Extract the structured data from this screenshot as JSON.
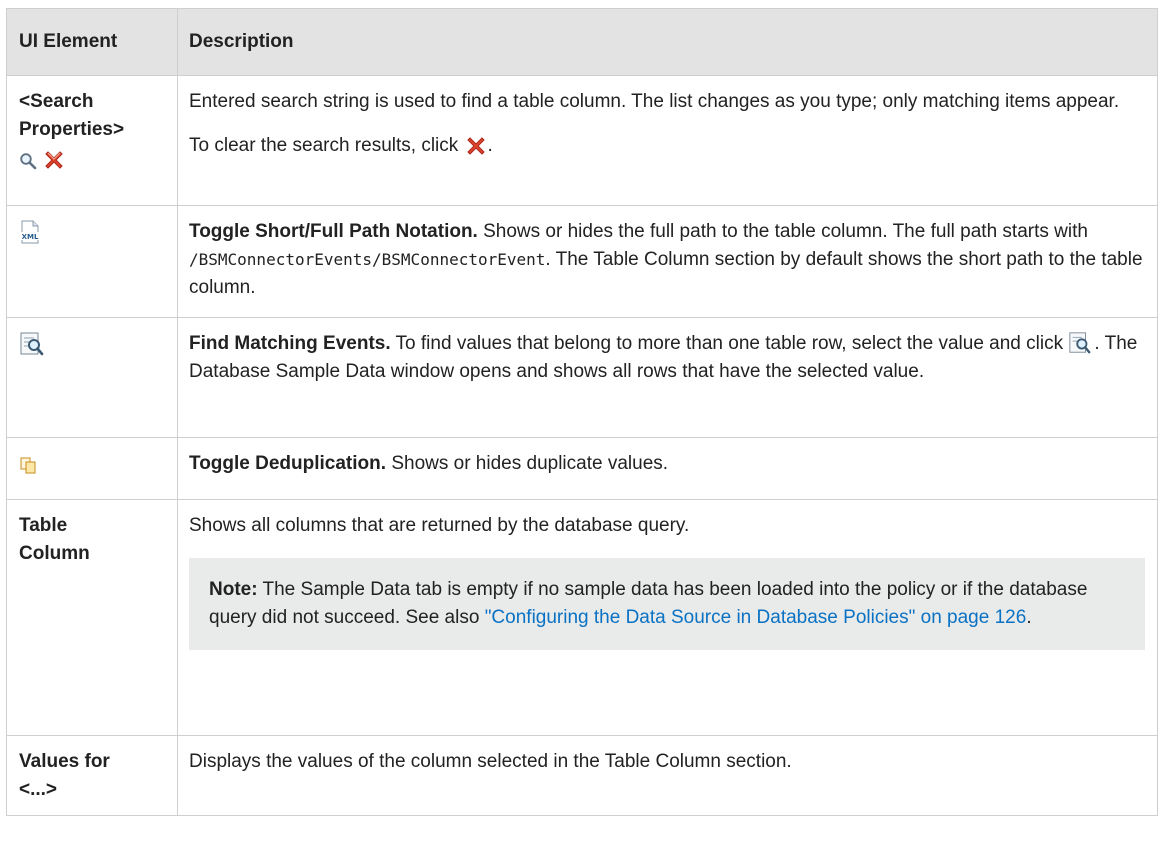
{
  "table": {
    "headers": {
      "element": "UI Element",
      "description": "Description"
    },
    "rows": {
      "search": {
        "element": "<Search Properties>",
        "element_line1": "<Search",
        "element_line2": "Properties>",
        "icons": [
          "magnifier-icon",
          "red-x-icon"
        ],
        "p1": "Entered search string is used to find a table column. The list changes as you type; only matching items appear.",
        "p2_pre": "To clear the search results, click",
        "p2_post": "."
      },
      "path": {
        "icon": "xml-icon",
        "title": "Toggle Short/Full Path Notation.",
        "text_a": " Shows or hides the full path to the table column. The full path starts with ",
        "code": "/BSMConnectorEvents/BSMConnectorEvent",
        "text_b": ". The Table Column section by default shows the short path to the table column."
      },
      "find": {
        "icon": "find-matching-events-icon",
        "title": "Find Matching Events.",
        "text_a": " To find values that belong to more than one table row, select the value and click ",
        "text_b": ". The Database Sample Data window opens and shows all rows that have the selected value."
      },
      "dedup": {
        "icon": "deduplication-icon",
        "title": "Toggle Deduplication.",
        "text": " Shows or hides duplicate values."
      },
      "table_column": {
        "element_line1": "Table",
        "element_line2": "Column",
        "text": "Shows all columns that are returned by the database query.",
        "note_label": "Note:",
        "note_text": " The Sample Data tab is empty if no sample data has been loaded into the policy or if the database query did not succeed. See also ",
        "note_link": "\"Configuring the Data Source in Database Policies\" on page 126",
        "note_end": "."
      },
      "values": {
        "element_line1": "Values for",
        "element_line2": "<...>",
        "text": "Displays the values of the column selected in the Table Column section."
      }
    }
  },
  "colors": {
    "header_bg": "#e3e3e3",
    "note_bg": "#e9eaea",
    "link": "#0a72c4",
    "border": "#cfcfcf"
  }
}
